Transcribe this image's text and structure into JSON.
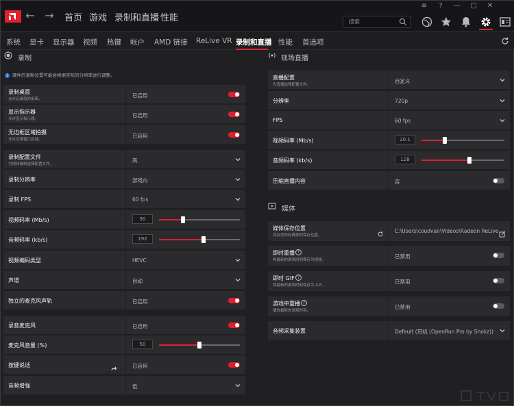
{
  "topbar": {
    "back_arrow": "←",
    "forward_arrow": "→",
    "nav": [
      "首页",
      "游戏",
      "录制和直播",
      "性能"
    ],
    "search_placeholder": "搜索",
    "window_controls": [
      "≡",
      "?",
      "—",
      "□",
      "✕"
    ],
    "accent": "#e0202e"
  },
  "subnav": {
    "tabs": [
      "系统",
      "显卡",
      "显示器",
      "视频",
      "热键",
      "帐户",
      "AMD 链接",
      "ReLive VR",
      "录制和直播",
      "性能",
      "首选项"
    ],
    "active_tab": "录制和直播"
  },
  "record": {
    "title": "录制",
    "info": "硬件的录制设置可能会根据实际的分辨率进行调整。",
    "rows": [
      {
        "label": "录制桌面",
        "sub": "允许记录您的桌面。",
        "value": "已启用",
        "control": "toggle-on"
      },
      {
        "label": "显示指示器",
        "sub": "允许显示指示器。",
        "value": "已启用",
        "control": "toggle-on"
      },
      {
        "label": "无边框区域拍摄",
        "sub": "允许记录窗口区域。",
        "value": "已启用",
        "control": "toggle-on"
      },
      {
        "label": "录制配置文件",
        "sub": "为视频录制选择配置文件。",
        "value": "高",
        "control": "dropdown"
      },
      {
        "label": "录制分辨率",
        "sub": "",
        "value": "游戏内",
        "control": "dropdown"
      },
      {
        "label": "录制 FPS",
        "sub": "",
        "value": "60 fps",
        "control": "dropdown"
      },
      {
        "label": "视频码率 (Mb/s)",
        "sub": "",
        "value": "30",
        "control": "slider",
        "level": 0.3
      },
      {
        "label": "音频码率 (kb/s)",
        "sub": "",
        "value": "192",
        "control": "slider",
        "level": 0.55
      },
      {
        "label": "视频编码类型",
        "sub": "",
        "value": "HEVC",
        "control": "dropdown"
      },
      {
        "label": "声道",
        "sub": "",
        "value": "自动",
        "control": "dropdown"
      },
      {
        "label": "独立的麦克风声轨",
        "sub": "",
        "value": "已启用",
        "control": "toggle-on"
      },
      {
        "label": "录音麦克风",
        "sub": "",
        "value": "已启用",
        "control": "toggle-on"
      },
      {
        "label": "麦克风音量 (%)",
        "sub": "",
        "value": "50",
        "control": "slider",
        "level": 0.5
      },
      {
        "label": "按键说话",
        "sub": "",
        "value": "已启用",
        "control": "toggle-on"
      },
      {
        "label": "音频增强",
        "sub": "",
        "value": "低",
        "control": "dropdown"
      }
    ]
  },
  "stream": {
    "title": "现场直播",
    "rows": [
      {
        "label": "直播配置",
        "sub": "为直播选择配置文件。",
        "value": "自定义",
        "control": "dropdown"
      },
      {
        "label": "分辨率",
        "sub": "",
        "value": "720p",
        "control": "dropdown"
      },
      {
        "label": "FPS",
        "sub": "",
        "value": "60 fps",
        "control": "dropdown"
      },
      {
        "label": "视频码率 (Mb/s)",
        "sub": "",
        "value": "20.1",
        "control": "slider",
        "level": 0.28
      },
      {
        "label": "音频码率 (kb/s)",
        "sub": "",
        "value": "128",
        "control": "slider",
        "level": 0.58
      },
      {
        "label": "压缩直播内容",
        "sub": "",
        "value": "否",
        "control": "toggle-off"
      }
    ]
  },
  "media": {
    "title": "媒体",
    "rows": [
      {
        "label": "媒体保存位置",
        "sub": "保存您所有媒体的保存位置。",
        "value": "C:\\Users\\coudvan\\Videos\\Radeon ReLive",
        "control": "path"
      },
      {
        "label": "即时重播",
        "sub": "将最新的游戏时刻保存为视频。",
        "value": "已禁用",
        "control": "toggle-off",
        "help": "?"
      },
      {
        "label": "即时 GIF",
        "sub": "将最新的游戏时刻保存为 GIF。",
        "value": "已禁用",
        "control": "toggle-off",
        "help": "?"
      },
      {
        "label": "游戏中重播",
        "sub": "播放最新的游戏时刻。",
        "value": "已禁用",
        "control": "toggle-off",
        "help": "?"
      },
      {
        "label": "音频采集装置",
        "sub": "",
        "value": "Default (耳机 (OpenRun Pro by Shokz))",
        "control": "dropdown"
      }
    ]
  }
}
